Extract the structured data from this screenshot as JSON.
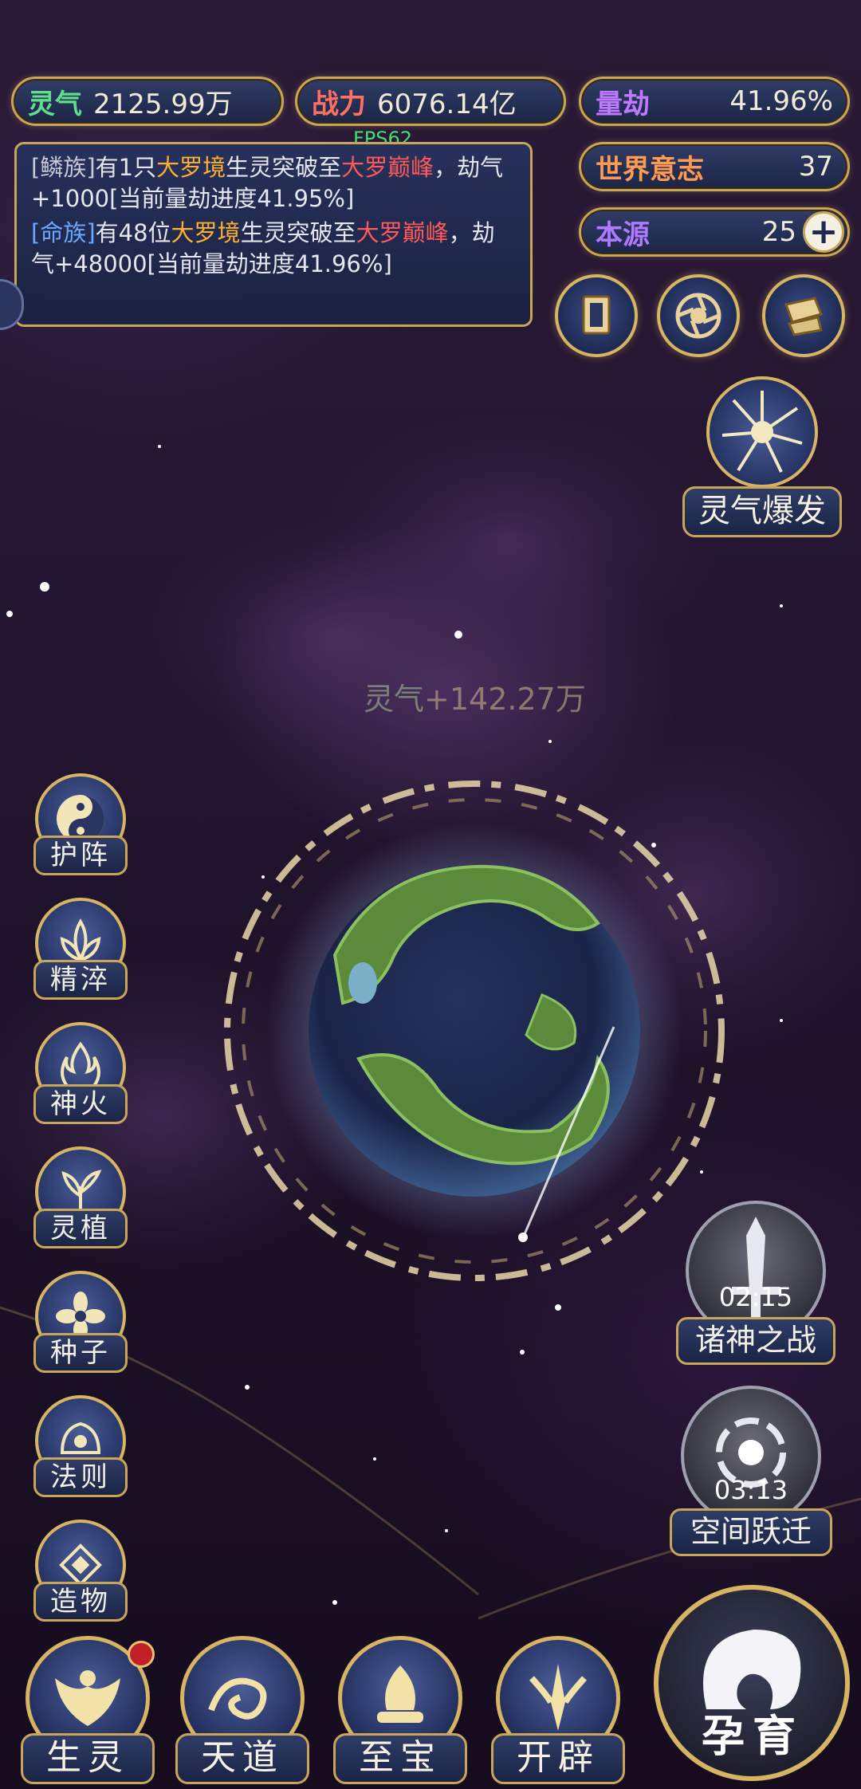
{
  "stats": {
    "lingqi": {
      "label": "灵气",
      "value": "2125.99万",
      "color": "#5ee08a"
    },
    "zhanli": {
      "label": "战力",
      "value": "6076.14亿",
      "color": "#ff7060"
    },
    "liangjie": {
      "label": "量劫",
      "value": "41.96%",
      "color": "#c07aff"
    },
    "shijie": {
      "label": "世界意志",
      "value": "37",
      "color": "#ff9a50"
    },
    "benyuan": {
      "label": "本源",
      "value": "25",
      "color": "#b07aff"
    }
  },
  "fps": "FPS62",
  "messages": [
    {
      "tribe": "[鳞族]",
      "t1": "有1只",
      "realm1": "大罗境",
      "t2": "生灵突破至",
      "realm2": "大罗巅峰",
      "t3": "，劫气+1000[当前量劫进度41.95%]"
    },
    {
      "tribe": "[命族]",
      "t1": "有48位",
      "realm1": "大罗境",
      "t2": "生灵突破至",
      "realm2": "大罗巅峰",
      "t3": "，劫气+48000[当前量劫进度41.96%]"
    }
  ],
  "top_icons": [
    "card-icon",
    "vortex-icon",
    "scroll-icon"
  ],
  "burst_label": "灵气爆发",
  "float_gain": {
    "key": "灵气",
    "value": "+142.27万"
  },
  "side_buttons": [
    {
      "label": "护阵",
      "icon": "yin-yang-icon"
    },
    {
      "label": "精淬",
      "icon": "lotus-flame-icon"
    },
    {
      "label": "神火",
      "icon": "fire-icon"
    },
    {
      "label": "灵植",
      "icon": "plant-icon"
    },
    {
      "label": "种子",
      "icon": "seed-flower-icon"
    },
    {
      "label": "法则",
      "icon": "rule-icon"
    },
    {
      "label": "造物",
      "icon": "creation-icon"
    }
  ],
  "timers": [
    {
      "label": "诸神之战",
      "time": "02:15",
      "icon": "sword-icon"
    },
    {
      "label": "空间跃迁",
      "time": "03:13",
      "icon": "portal-icon"
    }
  ],
  "bottom_nav": [
    {
      "label": "生灵",
      "icon": "phoenix-icon",
      "badge": true
    },
    {
      "label": "天道",
      "icon": "wave-icon",
      "badge": false
    },
    {
      "label": "至宝",
      "icon": "treasure-icon",
      "badge": false
    },
    {
      "label": "开辟",
      "icon": "axe-icon",
      "badge": false
    }
  ],
  "yunyu_label": "孕育",
  "colors": {
    "gold": "#c9a55a",
    "panel": "#26325c",
    "accent_gold": "#ffb030",
    "accent_red": "#ff5a5a"
  }
}
